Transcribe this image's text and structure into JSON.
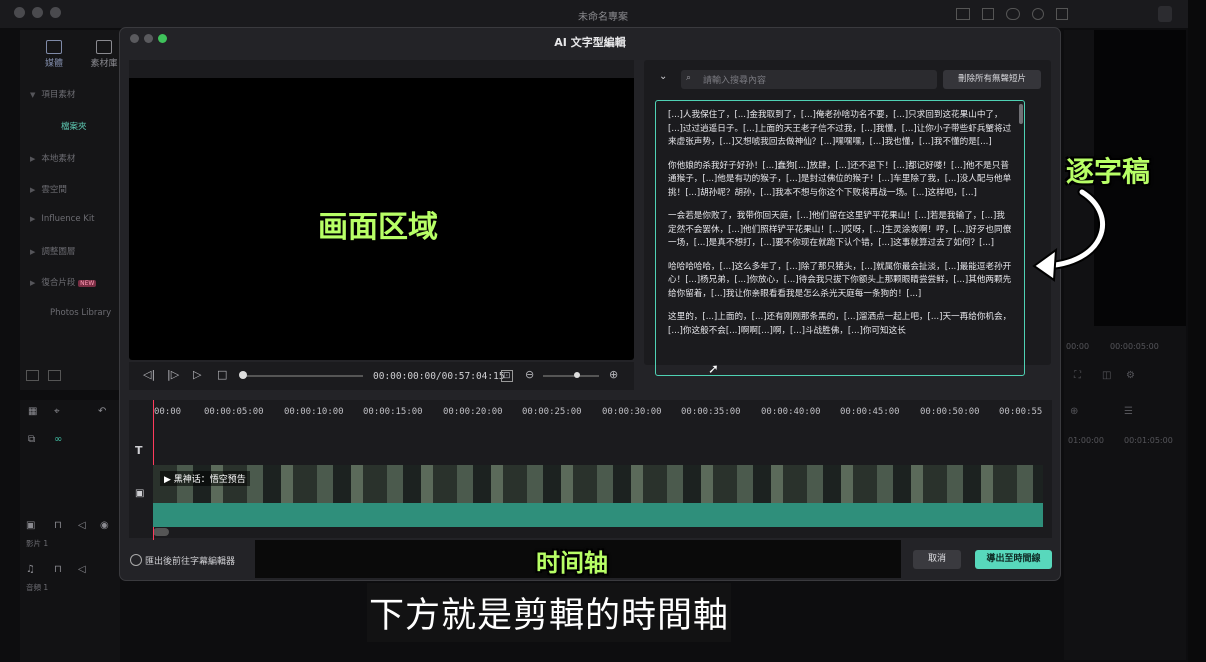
{
  "app": {
    "title": "未命名專案",
    "sidebar_tabs": [
      "媒體",
      "素材庫"
    ],
    "sidebar_items": [
      "項目素材",
      "檔案夾",
      "本地素材",
      "雲空間",
      "Influence Kit",
      "調整圖層",
      "復合片段",
      "Photos Library"
    ],
    "new_badge": "NEW",
    "tracks": [
      "影片 1",
      "音頻 1"
    ],
    "right_times": [
      "00:00",
      "00:00:05:00"
    ],
    "right_ticks": [
      "01:00:00",
      "00:01:05:00"
    ]
  },
  "dialog": {
    "title": "AI 文字型編輯",
    "search": {
      "placeholder": "請輸入搜尋內容"
    },
    "delete_silent_label": "刪除所有無聲短片",
    "player": {
      "time": "00:00:00:00/00:57:04:15",
      "progress_fraction": 0.0,
      "zoom_fraction": 0.6
    },
    "transcript": [
      "[...]人我保住了，[...]金我取到了，[...]俺老孙啥功名不要，[...]只求回到这花果山中了，[...]过过逍遥日子。[...]上面的天王老子信不过我，[...]我懂，[...]让你小子带些虾兵蟹将过来虚张声势，[...]又想唬我回去做神仙？[...]嘿嘿嘿，[...]我也懂，[...]我不懂的是[...]",
      "你他娘的杀我好子好孙！[...]蠢狗[...]放肆，[...]还不退下！[...]都记好喽！[...]他不是只普通猴子，[...]他是有功的猴子，[...]是封过佛位的猴子！[...]车里除了我，[...]没人配与他单挑！[...]胡孙呢？胡孙，[...]我本不想与你这个下败将再战一场。[...]这样吧，[...]",
      "一会若是你败了，我带你回天庭，[...]他们留在这里铲平花果山！[...]若是我输了，[...]我定然不会罢休，[...]他们照样铲平花果山！[...]哎呀，[...]生灵涂炭啊！哼，[...]好歹也同僚一场，[...]是真不想打，[...]要不你现在就跪下认个错，[...]这事就算过去了如何？[...]",
      "哈哈哈哈哈，[...]这么多年了，[...]除了那只猪头，[...]就属你最会扯淡，[...]最能逗老孙开心！[...]杨兄弟，[...]你放心，[...]待会我只拔下你额头上那颗眼睛尝尝鲜，[...]其他两颗先给你留着，[...]我让你亲眼看看我是怎么杀光天庭每一条狗的！[...]",
      "这里的，[...]上面的，[...]还有刚刚那条黑的，[...]溜洒点一起上吧，[...]天一再给你机会，[...]你这般不会[...]啊啊[...]啊，[...]斗战胜佛，[...]你可知这长"
    ],
    "timeline": {
      "ticks": [
        "00:00",
        "00:00:05:00",
        "00:00:10:00",
        "00:00:15:00",
        "00:00:20:00",
        "00:00:25:00",
        "00:00:30:00",
        "00:00:35:00",
        "00:00:40:00",
        "00:00:45:00",
        "00:00:50:00",
        "00:00:55"
      ],
      "clip_label": "黑神话：悟空预告"
    },
    "footer": {
      "checkbox_label": "匯出後前往字幕編輯器",
      "cancel_label": "取消",
      "export_label": "導出至時間線"
    }
  },
  "annotations": {
    "picture_area": "画面区域",
    "transcript_label": "逐字稿",
    "timeline_label": "时间轴"
  },
  "subtitle": "下方就是剪輯的時間軸",
  "colors": {
    "accent": "#58d8bc",
    "annotation": "#b8ff66",
    "playhead": "#ff3b5c"
  }
}
